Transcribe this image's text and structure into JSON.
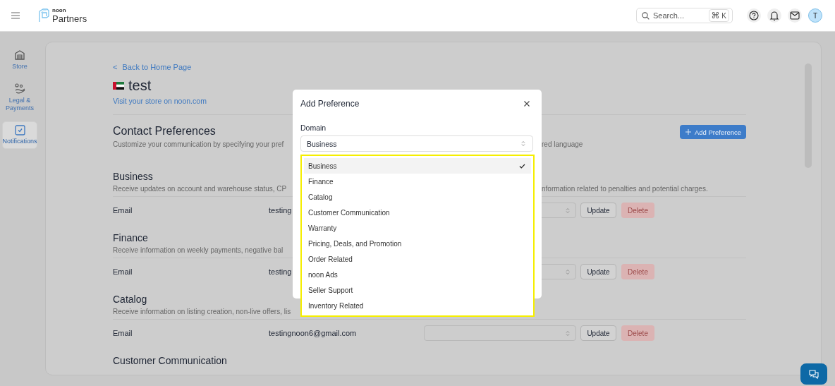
{
  "header": {
    "logo_top": "noon",
    "logo_bottom": "Partners",
    "search": {
      "placeholder": "Search...",
      "shortcut_symbol": "⌘",
      "shortcut_key": "K"
    },
    "avatar": "T"
  },
  "sidebar": {
    "items": [
      {
        "label": "Store",
        "selected": false
      },
      {
        "label": "Legal & Payments",
        "selected": false
      },
      {
        "label": "Notifications",
        "selected": true
      }
    ]
  },
  "page": {
    "back_arrow": "<",
    "back_link": "Back to Home Page",
    "store_name": "test",
    "visit_link": "Visit your store on noon.com",
    "heading": "Contact Preferences",
    "description_left": "Customize your communication by specifying your pref",
    "description_right": "red language",
    "add_button": "Add Preference",
    "sections": [
      {
        "title": "Business",
        "description_left": "Receive updates on account and warehouse status, CP",
        "description_right": "nformation related to penalties and potential charges.",
        "rows": [
          {
            "channel": "Email",
            "value": "testing",
            "update": "Update",
            "delete": "Delete",
            "delete_disabled": true
          }
        ]
      },
      {
        "title": "Finance",
        "description_left": "Receive information on weekly payments, negative bal",
        "rows": [
          {
            "channel": "Email",
            "value": "testing",
            "update": "Update",
            "delete": "Delete",
            "delete_disabled": true
          }
        ]
      },
      {
        "title": "Catalog",
        "description_left": "Receive information on listing creation, non-live offers, lis",
        "rows": [
          {
            "channel": "Email",
            "value": "testingnoon6@gmail.com",
            "update": "Update",
            "delete": "Delete",
            "delete_disabled": true
          }
        ]
      },
      {
        "title": "Customer Communication"
      }
    ]
  },
  "modal": {
    "title": "Add Preference",
    "field_label": "Domain",
    "value": "Business",
    "options": [
      {
        "label": "Business",
        "selected": true
      },
      {
        "label": "Finance",
        "selected": false
      },
      {
        "label": "Catalog",
        "selected": false
      },
      {
        "label": "Customer Communication",
        "selected": false
      },
      {
        "label": "Warranty",
        "selected": false
      },
      {
        "label": "Pricing, Deals, and Promotion",
        "selected": false
      },
      {
        "label": "Order Related",
        "selected": false
      },
      {
        "label": "noon Ads",
        "selected": false
      },
      {
        "label": "Seller Support",
        "selected": false
      },
      {
        "label": "Inventory Related",
        "selected": false
      }
    ]
  }
}
